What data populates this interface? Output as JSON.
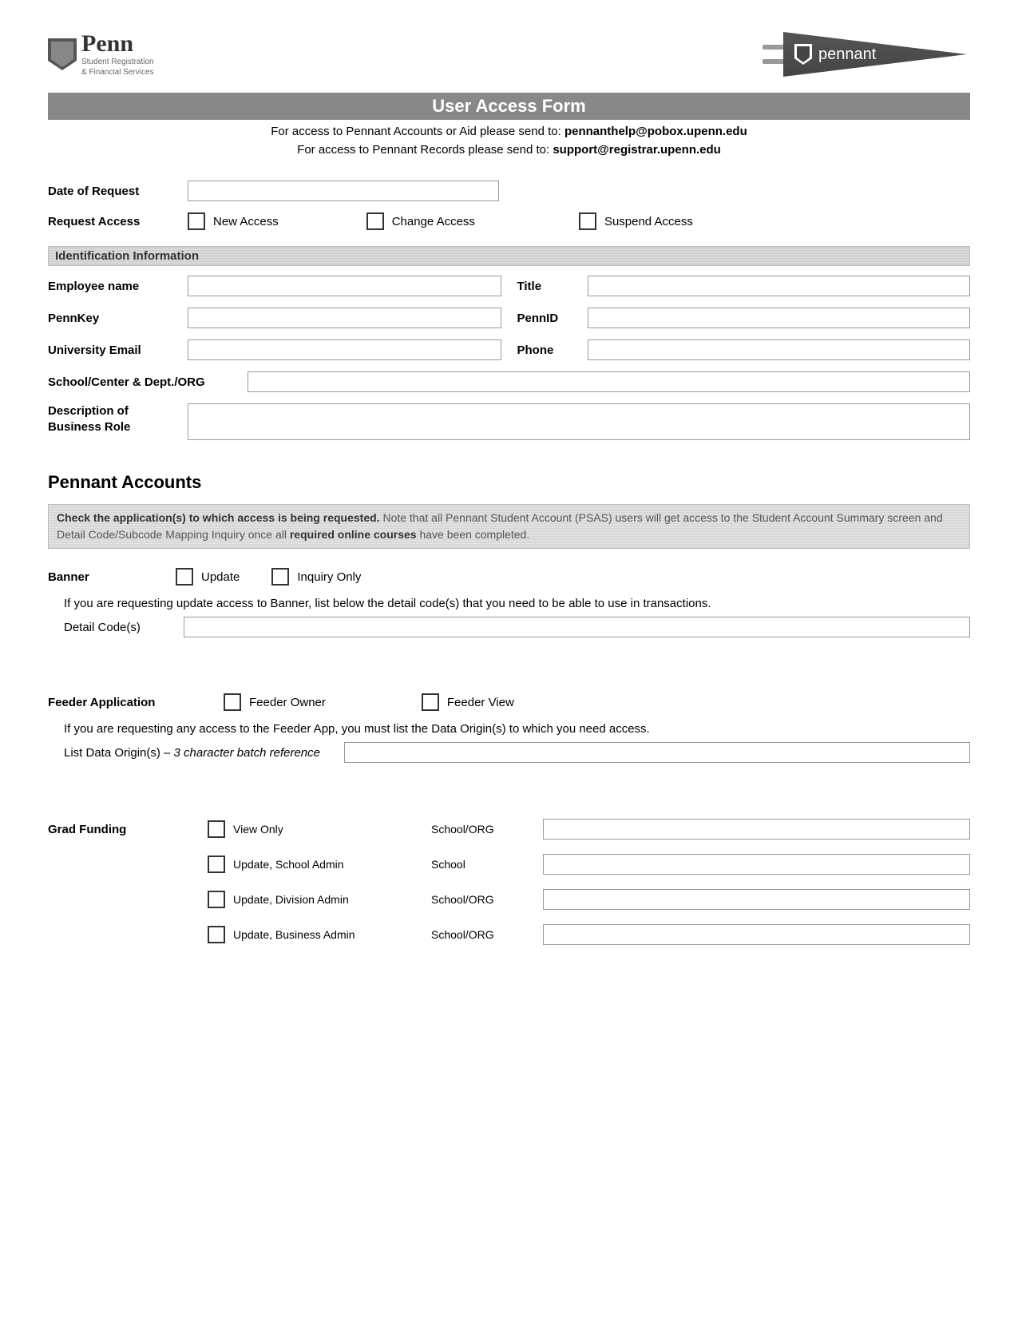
{
  "logo": {
    "penn": "Penn",
    "sub1": "Student Registration",
    "sub2": "& Financial Services",
    "flag": "pennant"
  },
  "title": "User Access Form",
  "intro1_pre": "For access to Pennant Accounts or Aid please send to: ",
  "intro1_email": "pennanthelp@pobox.upenn.edu",
  "intro2_pre": "For access to Pennant Records please send to: ",
  "intro2_email": "support@registrar.upenn.edu",
  "req": {
    "date_label": "Date of Request",
    "access_label": "Request Access",
    "opt_new": "New Access",
    "opt_change": "Change Access",
    "opt_suspend": "Suspend Access"
  },
  "id_section": {
    "header": "Identification Information",
    "emp_name": "Employee name",
    "title": "Title",
    "pennkey": "PennKey",
    "pennid": "PennID",
    "email": "University Email",
    "phone": "Phone",
    "school": "School/Center & Dept./ORG",
    "role": "Description of Business Role"
  },
  "pennant": {
    "heading": "Pennant Accounts",
    "note_b1": "Check the application(s) to which access is being requested.",
    "note_rest1": "  Note that all Pennant Student Account (PSAS) users will get access to the Student Account Summary screen and Detail Code/Subcode Mapping Inquiry once all ",
    "note_b2": "required online courses",
    "note_rest2": " have been completed."
  },
  "banner": {
    "label": "Banner",
    "update": "Update",
    "inquiry": "Inquiry Only",
    "instruct": "If you are requesting update access to Banner, list below the detail code(s) that you need to be able to use in transactions.",
    "detail_label": "Detail Code(s)"
  },
  "feeder": {
    "label": "Feeder Application",
    "owner": "Feeder Owner",
    "view": "Feeder View",
    "instruct": "If you are requesting any access to the Feeder App, you must list the Data Origin(s) to which you need access.",
    "origin_label": "List Data Origin(s) – ",
    "origin_italic": "3 character batch reference"
  },
  "grad": {
    "label": "Grad Funding",
    "viewonly": "View Only",
    "school_org": "School/ORG",
    "upd_school": "Update, School Admin",
    "school": "School",
    "upd_div": "Update, Division Admin",
    "upd_bus": "Update, Business Admin"
  }
}
